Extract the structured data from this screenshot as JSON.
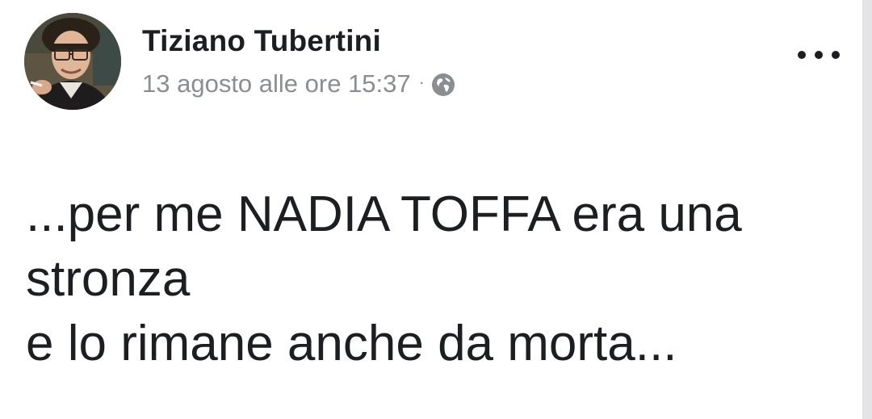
{
  "post": {
    "author": "Tiziano Tubertini",
    "timestamp": "13 agosto alle ore 15:37",
    "separator": "·",
    "privacy_icon": "globe-icon",
    "more_icon": "more-horizontal-icon",
    "lines": [
      "...per me NADIA TOFFA era una",
      "stronza",
      "e lo rimane anche da morta..."
    ]
  },
  "colors": {
    "text": "#1c1e21",
    "meta": "#8a8d91",
    "background": "#ffffff"
  }
}
